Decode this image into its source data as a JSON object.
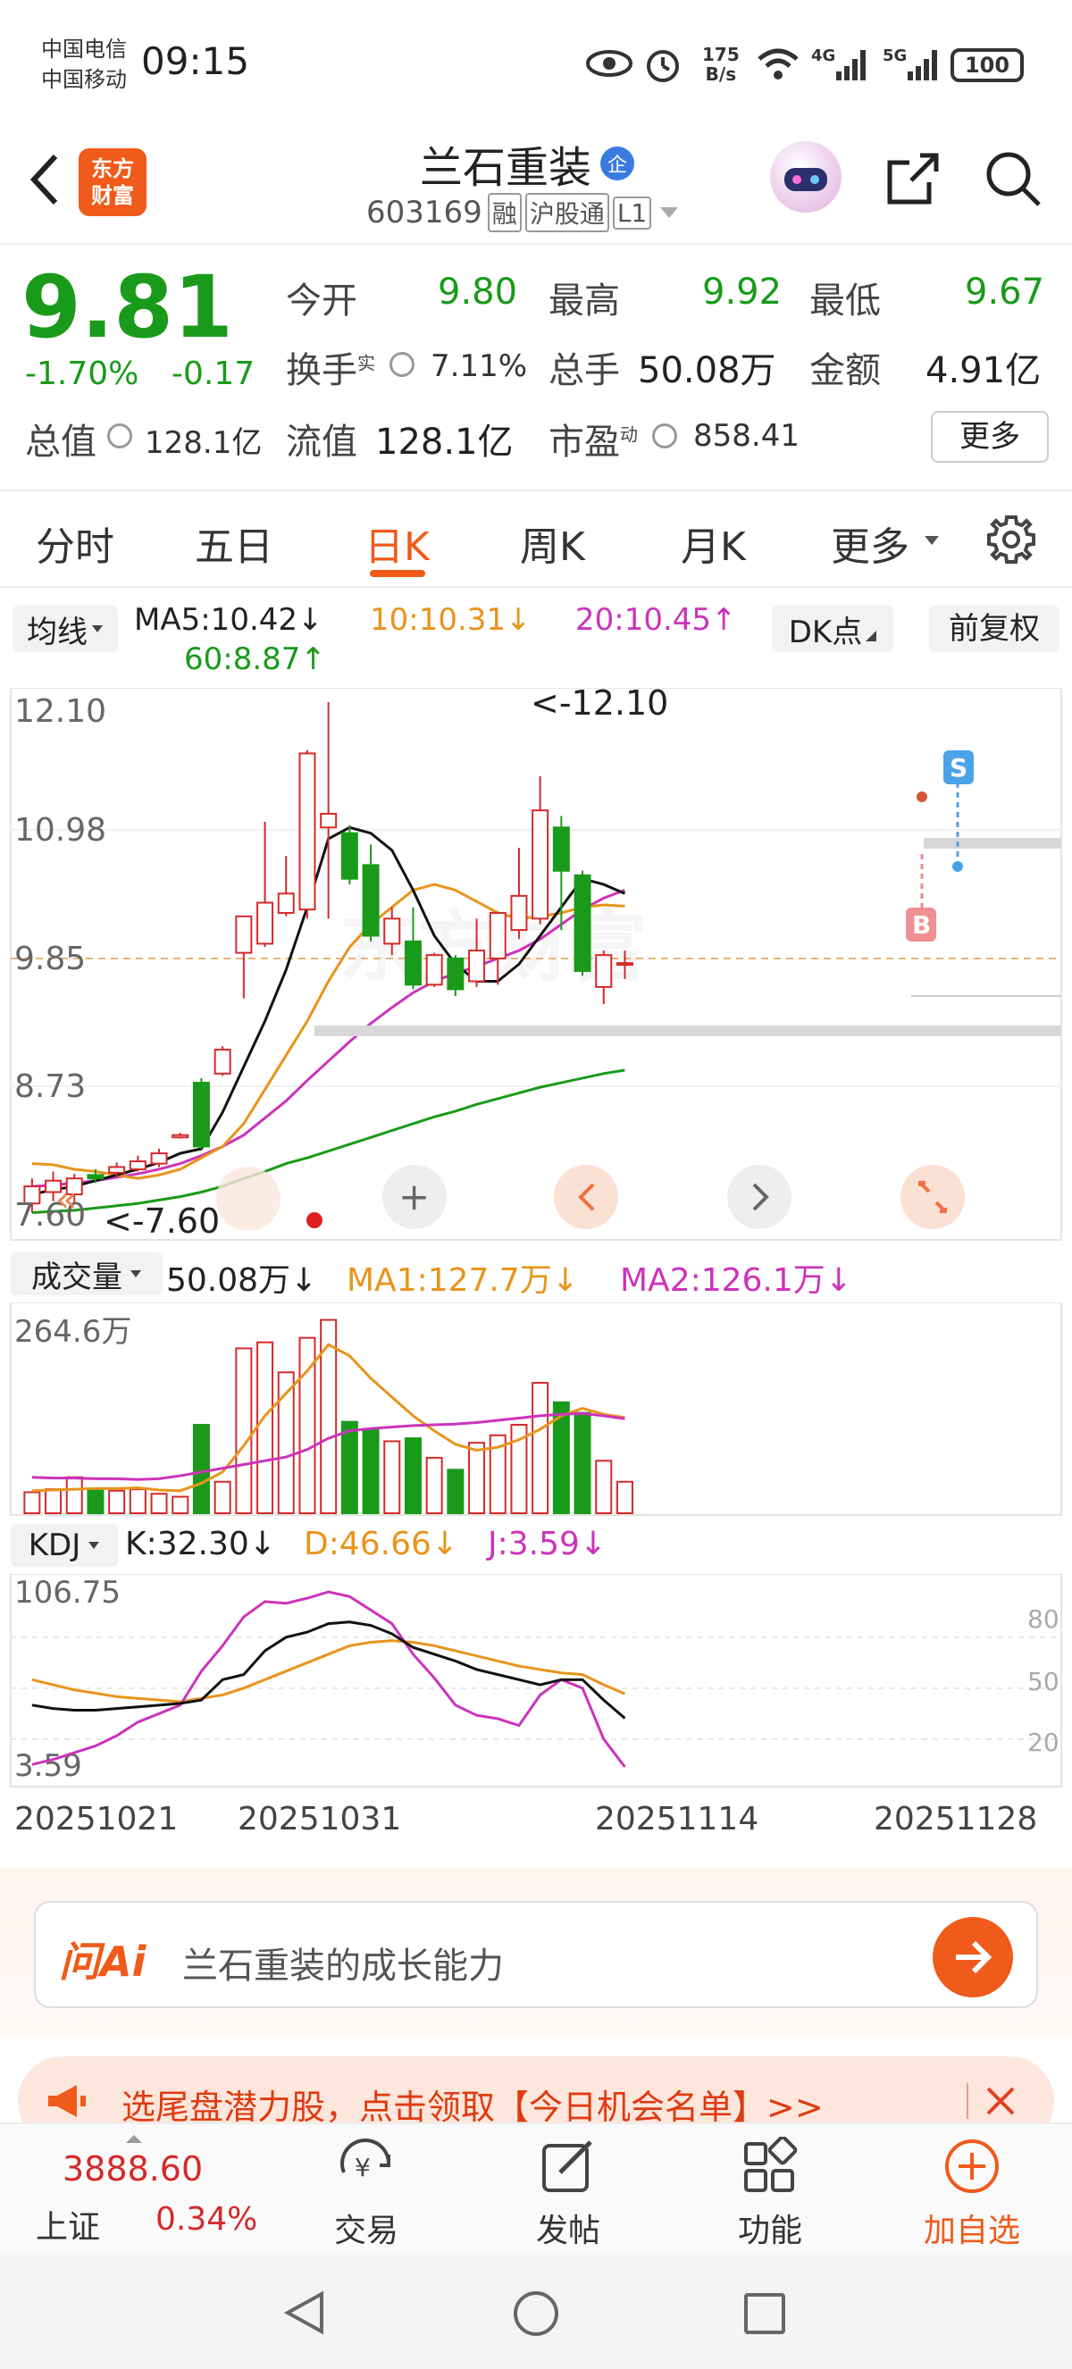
{
  "status_bar": {
    "carrier1": "中国电信",
    "carrier2": "中国移动",
    "time": "09:15",
    "net_speed_top": "175",
    "net_speed_bottom": "B/s",
    "battery": "100"
  },
  "header": {
    "back_icon": "chevron-left-icon",
    "logo_line1": "东方",
    "logo_line2": "财富",
    "stock_name": "兰石重装",
    "name_badge": "企",
    "stock_code": "603169",
    "tags": [
      "融",
      "沪股通",
      "L1"
    ],
    "share_icon": "share-icon",
    "search_icon": "search-icon"
  },
  "quote": {
    "price": "9.81",
    "change_pct": "-1.70%",
    "change": "-0.17",
    "open_label": "今开",
    "open": "9.80",
    "high_label": "最高",
    "high": "9.92",
    "low_label": "最低",
    "low": "9.67",
    "turnover_label": "换手",
    "turnover_sup": "实",
    "turnover": "7.11%",
    "volume_label": "总手",
    "volume": "50.08万",
    "amount_label": "金额",
    "amount": "4.91亿",
    "mktcap_label": "总值",
    "mktcap": "128.1亿",
    "float_label": "流值",
    "float": "128.1亿",
    "pe_label": "市盈",
    "pe_sup": "动",
    "pe": "858.41",
    "more_button": "更多"
  },
  "tabs": {
    "items": [
      "分时",
      "五日",
      "日K",
      "周K",
      "月K",
      "更多"
    ],
    "active": "日K"
  },
  "ma_bar": {
    "selector": "均线",
    "ma5": "MA5:10.42↓",
    "ma10": "10:10.31↓",
    "ma20": "20:10.45↑",
    "ma60": "60:8.87↑",
    "dk_button": "DK点",
    "adjust_button": "前复权"
  },
  "kline": {
    "axis_labels": [
      "12.10",
      "10.98",
      "9.85",
      "8.73",
      "7.60"
    ],
    "max_annotation": "<-12.10",
    "min_annotation": "<-7.60",
    "signal_s": "S",
    "signal_b": "B",
    "watermark": "东方财富"
  },
  "volume_bar": {
    "selector": "成交量",
    "value": "50.08万↓",
    "ma1": "MA1:127.7万↓",
    "ma2": "MA2:126.1万↓",
    "axis_top": "264.6万"
  },
  "kdj_bar": {
    "selector": "KDJ",
    "k": "K:32.30↓",
    "d": "D:46.66↓",
    "j": "J:3.59↓",
    "axis_top": "106.75",
    "axis_bottom": "3.59",
    "levels": [
      "80",
      "50",
      "20"
    ]
  },
  "date_axis": [
    "20251021",
    "20251031",
    "20251114",
    "20251128"
  ],
  "ai_box": {
    "logo": "问Ai",
    "placeholder": "兰石重装的成长能力"
  },
  "banner": {
    "text": "选尾盘潜力股，点击领取【今日机会名单】>>"
  },
  "bottom_nav": {
    "index_value": "3888.60",
    "index_name": "上证",
    "index_change": "0.34%",
    "items": [
      "交易",
      "发帖",
      "功能",
      "加自选"
    ]
  },
  "colors": {
    "up": "#d42a2a",
    "down": "#1a9a1a",
    "ma5": "#111111",
    "ma10": "#e8941b",
    "ma20": "#cc33bb",
    "ma60": "#1a9a1a",
    "accent": "#f05a1a"
  },
  "chart_data": {
    "type": "candlestick",
    "ylim": [
      7.6,
      12.1
    ],
    "candles": [
      {
        "o": 7.7,
        "c": 7.85,
        "h": 7.92,
        "l": 7.62
      },
      {
        "o": 7.8,
        "c": 7.9,
        "h": 7.98,
        "l": 7.72
      },
      {
        "o": 7.78,
        "c": 7.92,
        "h": 7.96,
        "l": 7.7
      },
      {
        "o": 7.95,
        "c": 7.92,
        "h": 8.0,
        "l": 7.88
      },
      {
        "o": 7.97,
        "c": 8.02,
        "h": 8.06,
        "l": 7.93
      },
      {
        "o": 8.0,
        "c": 8.07,
        "h": 8.12,
        "l": 7.98
      },
      {
        "o": 8.05,
        "c": 8.14,
        "h": 8.18,
        "l": 8.02
      },
      {
        "o": 8.28,
        "c": 8.3,
        "h": 8.32,
        "l": 8.27
      },
      {
        "o": 8.76,
        "c": 8.2,
        "h": 8.8,
        "l": 8.18
      },
      {
        "o": 8.84,
        "c": 9.05,
        "h": 9.08,
        "l": 8.82
      },
      {
        "o": 9.9,
        "c": 10.22,
        "h": 10.22,
        "l": 9.5
      },
      {
        "o": 9.98,
        "c": 10.34,
        "h": 11.05,
        "l": 9.95
      },
      {
        "o": 10.25,
        "c": 10.42,
        "h": 10.75,
        "l": 10.22
      },
      {
        "o": 10.28,
        "c": 11.65,
        "h": 11.68,
        "l": 10.2
      },
      {
        "o": 11.0,
        "c": 11.12,
        "h": 12.1,
        "l": 10.2
      },
      {
        "o": 10.95,
        "c": 10.55,
        "h": 11.02,
        "l": 10.5
      },
      {
        "o": 10.67,
        "c": 10.05,
        "h": 10.85,
        "l": 10.0
      },
      {
        "o": 9.98,
        "c": 10.2,
        "h": 10.3,
        "l": 9.88
      },
      {
        "o": 10.0,
        "c": 9.62,
        "h": 10.3,
        "l": 9.58
      },
      {
        "o": 9.62,
        "c": 9.88,
        "h": 9.9,
        "l": 9.6
      },
      {
        "o": 9.85,
        "c": 9.58,
        "h": 9.88,
        "l": 9.52
      },
      {
        "o": 9.65,
        "c": 9.92,
        "h": 10.2,
        "l": 9.6
      },
      {
        "o": 9.85,
        "c": 10.25,
        "h": 10.26,
        "l": 9.62
      },
      {
        "o": 10.1,
        "c": 10.4,
        "h": 10.82,
        "l": 10.02
      },
      {
        "o": 10.2,
        "c": 11.15,
        "h": 11.45,
        "l": 10.15
      },
      {
        "o": 11.0,
        "c": 10.62,
        "h": 11.1,
        "l": 10.1
      },
      {
        "o": 10.58,
        "c": 9.74,
        "h": 10.62,
        "l": 9.7
      },
      {
        "o": 9.6,
        "c": 9.88,
        "h": 9.92,
        "l": 9.45
      },
      {
        "o": 9.8,
        "c": 9.81,
        "h": 9.92,
        "l": 9.67
      }
    ],
    "ma5": [
      7.78,
      7.82,
      7.85,
      7.9,
      7.95,
      8.0,
      8.06,
      8.14,
      8.18,
      8.5,
      8.9,
      9.3,
      9.75,
      10.3,
      10.9,
      11.0,
      10.95,
      10.8,
      10.45,
      10.05,
      9.8,
      9.65,
      9.65,
      9.8,
      10.05,
      10.3,
      10.55,
      10.5,
      10.42
    ],
    "ma10": [
      8.05,
      8.04,
      8.0,
      7.98,
      7.95,
      7.92,
      7.95,
      8.0,
      8.1,
      8.2,
      8.4,
      8.7,
      9.0,
      9.3,
      9.65,
      9.95,
      10.15,
      10.3,
      10.45,
      10.5,
      10.45,
      10.35,
      10.25,
      10.2,
      10.22,
      10.25,
      10.3,
      10.32,
      10.31
    ],
    "ma20": [
      7.85,
      7.86,
      7.88,
      7.9,
      7.93,
      7.96,
      8.0,
      8.05,
      8.12,
      8.2,
      8.3,
      8.45,
      8.6,
      8.78,
      8.95,
      9.12,
      9.28,
      9.42,
      9.55,
      9.65,
      9.72,
      9.78,
      9.85,
      9.92,
      10.02,
      10.15,
      10.28,
      10.38,
      10.45
    ],
    "ma60": [
      7.62,
      7.63,
      7.64,
      7.66,
      7.68,
      7.7,
      7.73,
      7.76,
      7.8,
      7.85,
      7.92,
      7.98,
      8.05,
      8.1,
      8.16,
      8.22,
      8.28,
      8.34,
      8.4,
      8.46,
      8.51,
      8.57,
      8.62,
      8.67,
      8.72,
      8.76,
      8.8,
      8.84,
      8.87
    ],
    "volume": [
      28,
      32,
      48,
      32,
      30,
      32,
      26,
      22,
      118,
      42,
      220,
      228,
      188,
      234,
      258,
      122,
      112,
      96,
      100,
      74,
      58,
      94,
      104,
      118,
      174,
      148,
      134,
      70,
      42
    ],
    "vol_ma1": [
      30,
      31,
      32,
      33,
      33,
      34,
      31,
      30,
      40,
      55,
      90,
      130,
      160,
      190,
      225,
      210,
      180,
      155,
      130,
      110,
      92,
      84,
      88,
      98,
      112,
      130,
      140,
      132,
      127.7
    ],
    "vol_ma2": [
      48,
      47,
      47,
      46,
      46,
      45,
      46,
      50,
      55,
      60,
      65,
      70,
      75,
      85,
      100,
      110,
      113,
      115,
      117,
      118,
      119,
      121,
      124,
      127,
      130,
      132,
      133,
      130,
      126.1
    ],
    "kdj_k": [
      40,
      38,
      37,
      37,
      38,
      39,
      40,
      41,
      43,
      55,
      58,
      72,
      80,
      83,
      88,
      89,
      87,
      82,
      74,
      70,
      66,
      61,
      58,
      55,
      52,
      55,
      55,
      43,
      32.3
    ],
    "kdj_d": [
      55,
      52,
      49,
      47,
      45,
      44,
      43,
      42,
      44,
      46,
      50,
      55,
      60,
      65,
      70,
      75,
      77,
      78,
      77,
      75,
      72,
      69,
      66,
      63,
      61,
      59,
      58,
      52,
      46.66
    ],
    "kdj_j": [
      5,
      8,
      12,
      16,
      22,
      30,
      35,
      40,
      60,
      75,
      92,
      101,
      100,
      103,
      106.75,
      104,
      96,
      88,
      70,
      56,
      40,
      34,
      32,
      28,
      46,
      55,
      50,
      20,
      3.59
    ]
  }
}
